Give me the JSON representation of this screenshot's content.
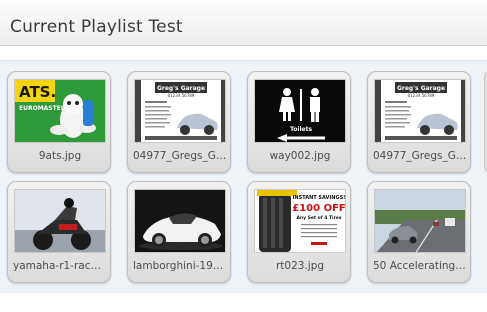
{
  "panel": {
    "title": "Current Playlist Test"
  },
  "playlist": [
    {
      "filename": "9ats.jpg",
      "thumb_icon": "ats-euromaster-ad-image"
    },
    {
      "filename": "04977_Gregs_Gar...",
      "thumb_icon": "gregs-garage-flyer-image"
    },
    {
      "filename": "way002.jpg",
      "thumb_icon": "toilets-sign-image"
    },
    {
      "filename": "04977_Gregs_Gar...",
      "thumb_icon": "gregs-garage-flyer-image"
    },
    {
      "filename": "yamaha-r1-race-...",
      "thumb_icon": "motorbike-racer-image"
    },
    {
      "filename": "lamborghini-1920...",
      "thumb_icon": "white-sports-car-image"
    },
    {
      "filename": "rt023.jpg",
      "thumb_icon": "tyre-offer-ad-image"
    },
    {
      "filename": "50 Accelerating ...",
      "thumb_icon": "cars-on-road-image"
    }
  ],
  "thumb_text": {
    "ats": "ATS.",
    "euromaster": "EUROMASTER",
    "gregs": "Greg's Garage",
    "phone": "01234 56789",
    "toilets": "Toilets",
    "instant": "INSTANT SAVINGS!",
    "offer": "£100 OFF",
    "any_set": "Any Set of 4 Tires"
  }
}
